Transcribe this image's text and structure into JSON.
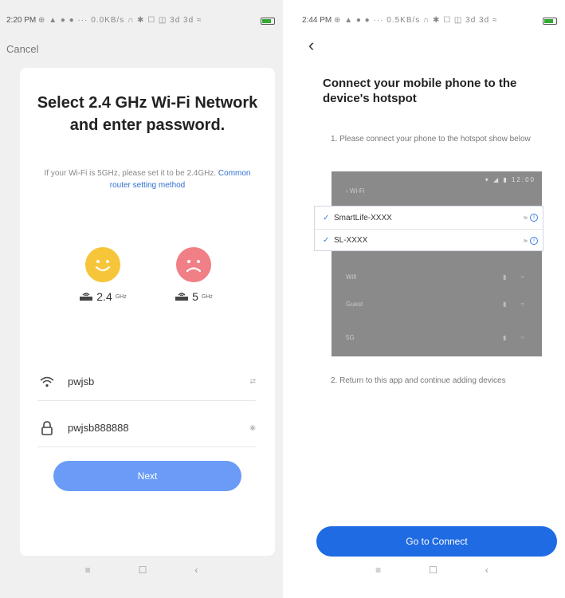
{
  "left": {
    "status": {
      "time": "2:20 PM",
      "icons": "⊕ ▲ ● ● ··· 0.0KB/s ∩ ✱ ☐ ◫ 3d 3d ≈",
      "battery": "battery-icon"
    },
    "cancel_label": "Cancel",
    "card": {
      "title": "Select 2.4 GHz Wi-Fi Network and enter password.",
      "subtitle": "If your Wi-Fi is 5GHz, please set it to be 2.4GHz.",
      "subtitle_link": "Common router setting method"
    },
    "bands": [
      {
        "label": "2.4",
        "unit": "GHz",
        "mood": "happy",
        "color": "#f6c53a"
      },
      {
        "label": "5",
        "unit": "GHz",
        "mood": "sad",
        "color": "#f07f86"
      }
    ],
    "wifi": {
      "value": "pwjsb",
      "icon": "wifi-icon",
      "trail": "⇄"
    },
    "password": {
      "value": "pwjsb888888",
      "icon": "lock-icon",
      "trail": "◉"
    },
    "next_label": "Next",
    "accent": "#6a9cf7"
  },
  "right": {
    "status": {
      "time": "2:44 PM",
      "icons": "⊕ ▲ ● ● ··· 0.5KB/s ∩ ✱ ☐ ◫ 3d 3d ≈",
      "battery": "battery-icon"
    },
    "title": "Connect your mobile phone to the device's hotspot",
    "step1": "1. Please connect your phone to the hotspot show below",
    "step2": "2. Return to this app and continue adding devices",
    "mock": {
      "status": "▾ ◢ ▮ 12:00",
      "header": "‹ Wi-Fi",
      "rows": [
        "Wifi",
        "Guest",
        "5G"
      ]
    },
    "hotspots": [
      {
        "ssid": "SmartLife-XXXX"
      },
      {
        "ssid": "SL-XXXX"
      }
    ],
    "connect_label": "Go to Connect",
    "accent": "#1f6be3"
  },
  "navbar": {
    "menu": "≡",
    "home": "☐",
    "back": "‹"
  }
}
